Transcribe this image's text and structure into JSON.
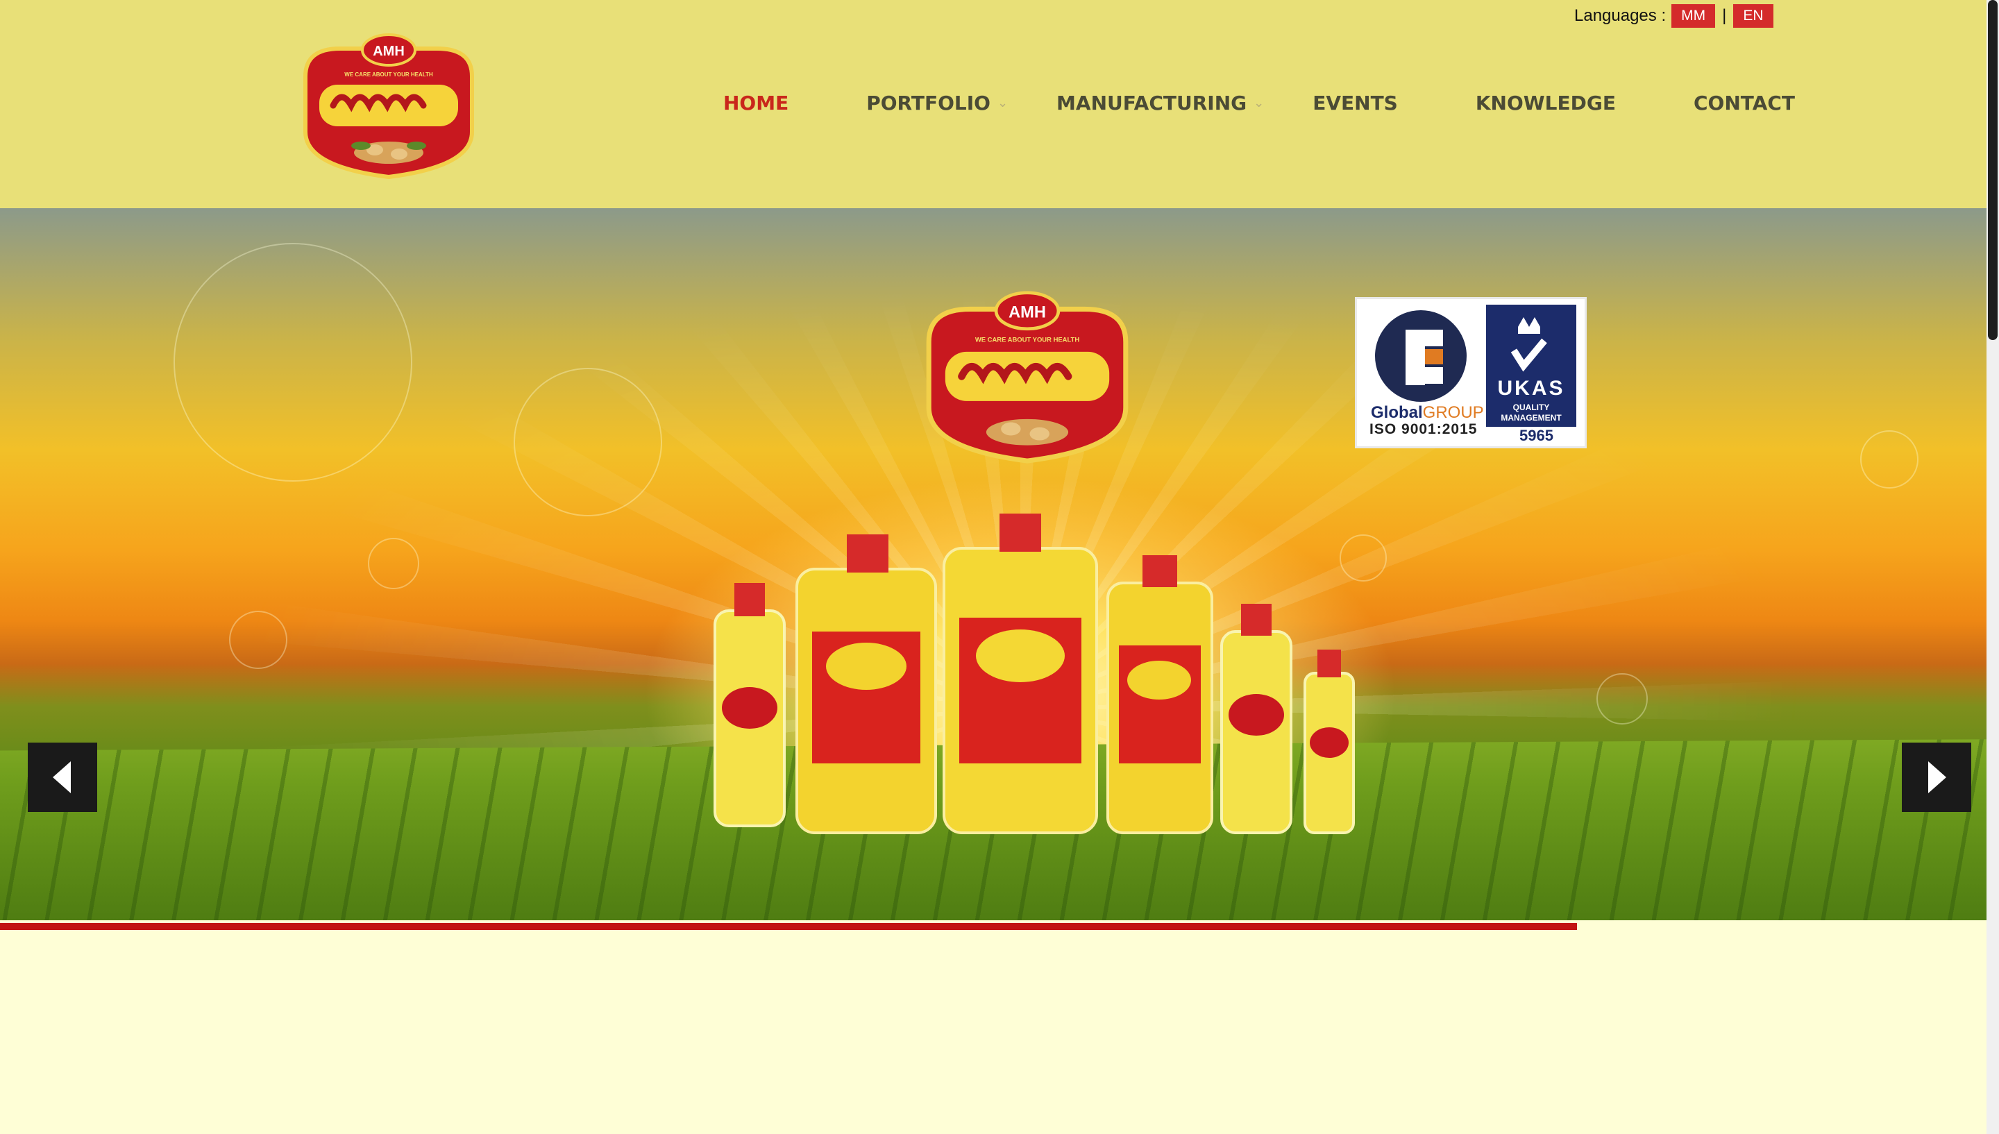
{
  "languages": {
    "label": "Languages :",
    "options": [
      "MM",
      "EN"
    ],
    "separator": "|"
  },
  "brand": {
    "logo_top_text": "AMH",
    "logo_tagline": "WE CARE ABOUT YOUR HEALTH"
  },
  "nav": {
    "items": [
      {
        "label": "HOME",
        "active": true,
        "has_dropdown": false
      },
      {
        "label": "PORTFOLIO",
        "active": false,
        "has_dropdown": true
      },
      {
        "label": "MANUFACTURING",
        "active": false,
        "has_dropdown": true
      },
      {
        "label": "EVENTS",
        "active": false,
        "has_dropdown": false
      },
      {
        "label": "KNOWLEDGE",
        "active": false,
        "has_dropdown": false
      },
      {
        "label": "CONTACT",
        "active": false,
        "has_dropdown": false
      }
    ]
  },
  "slider": {
    "certificate": {
      "global_a": "Global",
      "global_b": "GROUP",
      "iso": "ISO 9001:2015",
      "ukas_title": "UKAS",
      "ukas_sub1": "QUALITY",
      "ukas_sub2": "MANAGEMENT",
      "ukas_number": "5965"
    },
    "slide_count": 7,
    "active_slide": 1,
    "progress_fraction": 0.794
  },
  "colors": {
    "header_bg": "#e8e078",
    "page_bg": "#fefed6",
    "accent_red": "#d42b2b",
    "nav_text": "#4b4b35",
    "nav_active": "#c9271b"
  },
  "icons": {
    "prev": "arrow-left-icon",
    "next": "arrow-right-icon",
    "dropdown": "chevron-down-icon"
  }
}
